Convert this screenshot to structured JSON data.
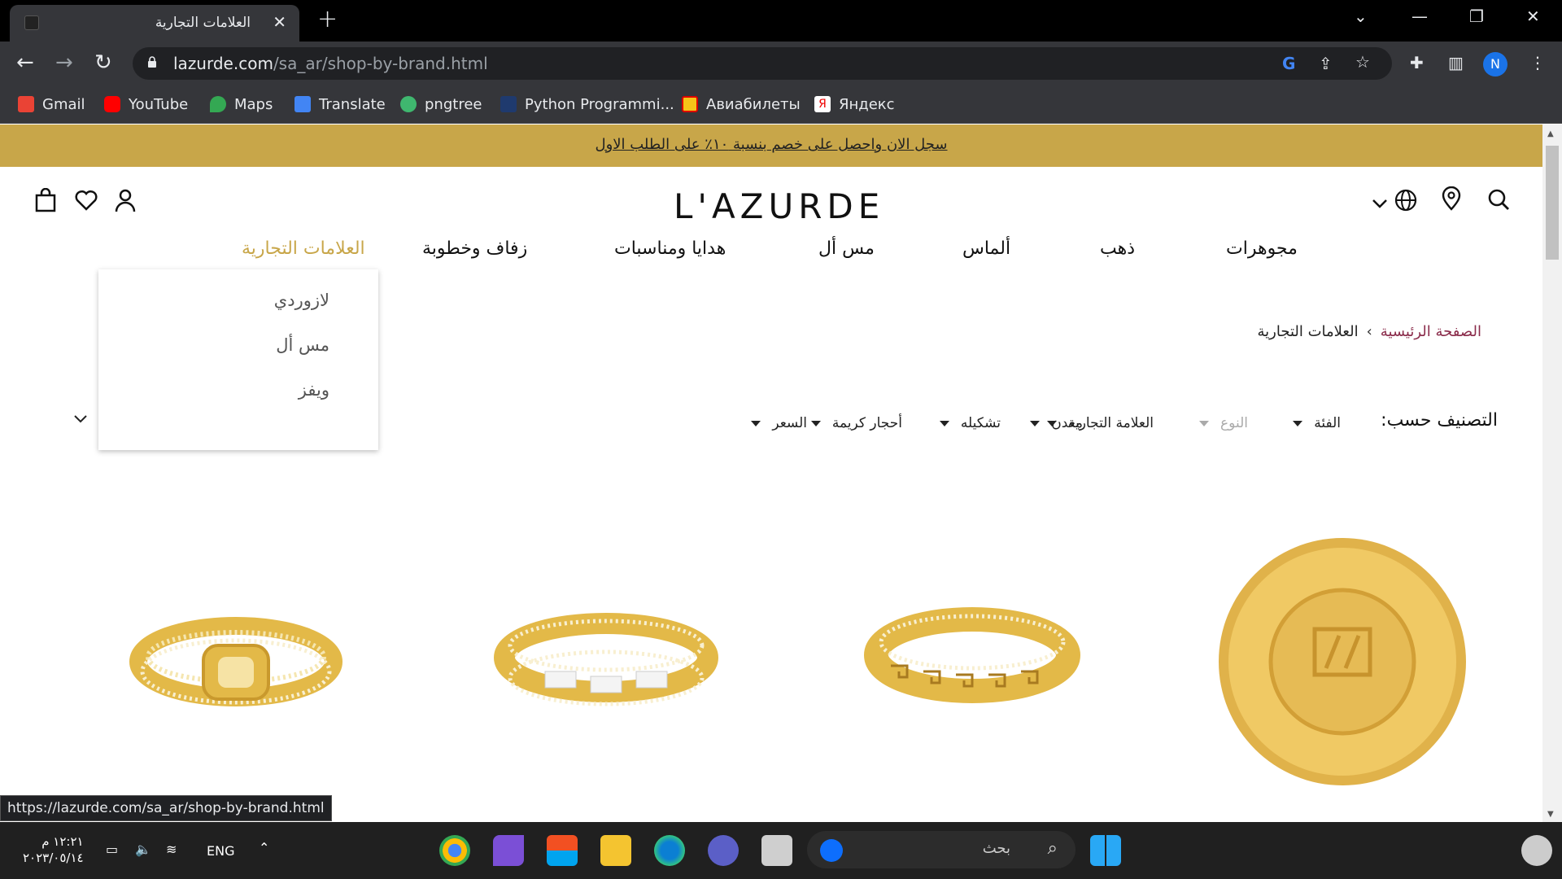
{
  "browser": {
    "tab_title": "العلامات التجارية",
    "url_domain": "lazurde.com",
    "url_path": "/sa_ar/shop-by-brand.html",
    "profile_initial": "N",
    "bookmarks": [
      "Gmail",
      "YouTube",
      "Maps",
      "Translate",
      "pngtree",
      "Python Programmi...",
      "Авиабилеты",
      "Яндекс"
    ],
    "status_url": "https://lazurde.com/sa_ar/shop-by-brand.html"
  },
  "site": {
    "promo_text": "سجل الان واحصل على خصم بنسبة ١٠٪ على الطلب الاول",
    "logo": "L'AZURDE",
    "nav": [
      "مجوهرات",
      "ذهب",
      "ألماس",
      "مس أل",
      "هدايا ومناسبات",
      "زفاف وخطوبة",
      "العلامات التجارية"
    ],
    "dropdown": [
      "لازوردي",
      "مس أل",
      "ويفز"
    ],
    "breadcrumb": {
      "home": "الصفحة الرئيسية",
      "separator": "›",
      "current": "العلامات التجارية"
    },
    "sort_label": "التصنيف حسب:",
    "filters": [
      "الفئة",
      "النوع",
      "العلامة التجارية",
      "معدن",
      "تشكيله",
      "أحجار كريمة",
      "السعر"
    ]
  },
  "taskbar": {
    "search_placeholder": "بحث",
    "lang": "ENG",
    "time": "١٢:٢١ م",
    "date": "٢٠٢٣/٠٥/١٤"
  },
  "colors": {
    "brand_gold": "#c8a649",
    "breadcrumb_home": "#8a2b4a"
  }
}
